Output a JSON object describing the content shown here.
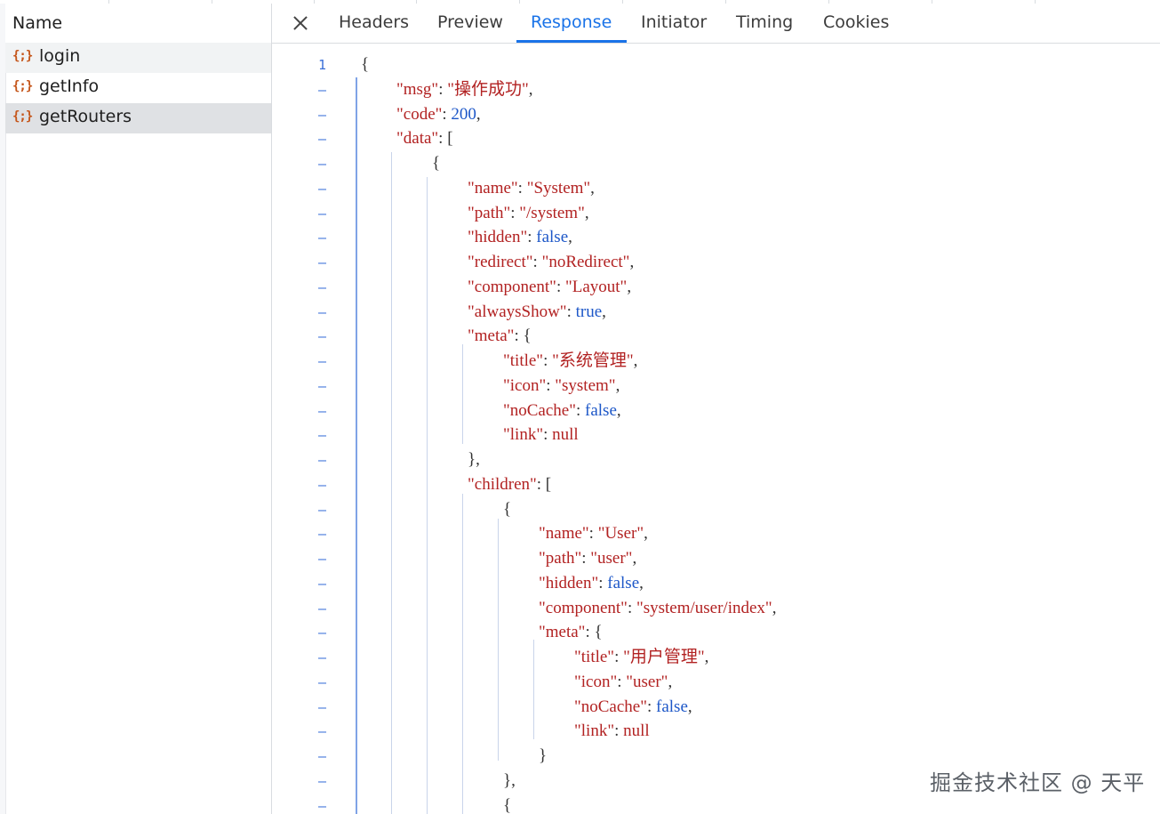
{
  "requests_header": "Name",
  "requests": [
    {
      "label": "login",
      "icon": "json-icon",
      "state": "alt"
    },
    {
      "label": "getInfo",
      "icon": "json-icon",
      "state": "normal"
    },
    {
      "label": "getRouters",
      "icon": "json-icon",
      "state": "selected"
    }
  ],
  "icon_glyph": "{;}",
  "tabs": [
    "Headers",
    "Preview",
    "Response",
    "Initiator",
    "Timing",
    "Cookies"
  ],
  "active_tab": "Response",
  "gutter": {
    "first": "1",
    "collapsed": "–"
  },
  "colors": {
    "accent": "#1a73e8",
    "string": "#b22222",
    "literal": "#1d57c8",
    "json_icon": "#c5561b"
  },
  "code_lines": [
    [
      {
        "t": "p",
        "v": "{"
      }
    ],
    [
      {
        "t": "k",
        "v": "\"msg\""
      },
      {
        "t": "p",
        "v": ": "
      },
      {
        "t": "s",
        "v": "\"操作成功\""
      },
      {
        "t": "p",
        "v": ","
      }
    ],
    [
      {
        "t": "k",
        "v": "\"code\""
      },
      {
        "t": "p",
        "v": ": "
      },
      {
        "t": "n",
        "v": "200"
      },
      {
        "t": "p",
        "v": ","
      }
    ],
    [
      {
        "t": "k",
        "v": "\"data\""
      },
      {
        "t": "p",
        "v": ": ["
      }
    ],
    [
      {
        "t": "p",
        "v": "{"
      }
    ],
    [
      {
        "t": "k",
        "v": "\"name\""
      },
      {
        "t": "p",
        "v": ": "
      },
      {
        "t": "s",
        "v": "\"System\""
      },
      {
        "t": "p",
        "v": ","
      }
    ],
    [
      {
        "t": "k",
        "v": "\"path\""
      },
      {
        "t": "p",
        "v": ": "
      },
      {
        "t": "s",
        "v": "\"/system\""
      },
      {
        "t": "p",
        "v": ","
      }
    ],
    [
      {
        "t": "k",
        "v": "\"hidden\""
      },
      {
        "t": "p",
        "v": ": "
      },
      {
        "t": "n",
        "v": "false"
      },
      {
        "t": "p",
        "v": ","
      }
    ],
    [
      {
        "t": "k",
        "v": "\"redirect\""
      },
      {
        "t": "p",
        "v": ": "
      },
      {
        "t": "s",
        "v": "\"noRedirect\""
      },
      {
        "t": "p",
        "v": ","
      }
    ],
    [
      {
        "t": "k",
        "v": "\"component\""
      },
      {
        "t": "p",
        "v": ": "
      },
      {
        "t": "s",
        "v": "\"Layout\""
      },
      {
        "t": "p",
        "v": ","
      }
    ],
    [
      {
        "t": "k",
        "v": "\"alwaysShow\""
      },
      {
        "t": "p",
        "v": ": "
      },
      {
        "t": "n",
        "v": "true"
      },
      {
        "t": "p",
        "v": ","
      }
    ],
    [
      {
        "t": "k",
        "v": "\"meta\""
      },
      {
        "t": "p",
        "v": ": {"
      }
    ],
    [
      {
        "t": "k",
        "v": "\"title\""
      },
      {
        "t": "p",
        "v": ": "
      },
      {
        "t": "s",
        "v": "\"系统管理\""
      },
      {
        "t": "p",
        "v": ","
      }
    ],
    [
      {
        "t": "k",
        "v": "\"icon\""
      },
      {
        "t": "p",
        "v": ": "
      },
      {
        "t": "s",
        "v": "\"system\""
      },
      {
        "t": "p",
        "v": ","
      }
    ],
    [
      {
        "t": "k",
        "v": "\"noCache\""
      },
      {
        "t": "p",
        "v": ": "
      },
      {
        "t": "n",
        "v": "false"
      },
      {
        "t": "p",
        "v": ","
      }
    ],
    [
      {
        "t": "k",
        "v": "\"link\""
      },
      {
        "t": "p",
        "v": ": "
      },
      {
        "t": "s",
        "v": "null"
      }
    ],
    [
      {
        "t": "p",
        "v": "},"
      }
    ],
    [
      {
        "t": "k",
        "v": "\"children\""
      },
      {
        "t": "p",
        "v": ": ["
      }
    ],
    [
      {
        "t": "p",
        "v": "{"
      }
    ],
    [
      {
        "t": "k",
        "v": "\"name\""
      },
      {
        "t": "p",
        "v": ": "
      },
      {
        "t": "s",
        "v": "\"User\""
      },
      {
        "t": "p",
        "v": ","
      }
    ],
    [
      {
        "t": "k",
        "v": "\"path\""
      },
      {
        "t": "p",
        "v": ": "
      },
      {
        "t": "s",
        "v": "\"user\""
      },
      {
        "t": "p",
        "v": ","
      }
    ],
    [
      {
        "t": "k",
        "v": "\"hidden\""
      },
      {
        "t": "p",
        "v": ": "
      },
      {
        "t": "n",
        "v": "false"
      },
      {
        "t": "p",
        "v": ","
      }
    ],
    [
      {
        "t": "k",
        "v": "\"component\""
      },
      {
        "t": "p",
        "v": ": "
      },
      {
        "t": "s",
        "v": "\"system/user/index\""
      },
      {
        "t": "p",
        "v": ","
      }
    ],
    [
      {
        "t": "k",
        "v": "\"meta\""
      },
      {
        "t": "p",
        "v": ": {"
      }
    ],
    [
      {
        "t": "k",
        "v": "\"title\""
      },
      {
        "t": "p",
        "v": ": "
      },
      {
        "t": "s",
        "v": "\"用户管理\""
      },
      {
        "t": "p",
        "v": ","
      }
    ],
    [
      {
        "t": "k",
        "v": "\"icon\""
      },
      {
        "t": "p",
        "v": ": "
      },
      {
        "t": "s",
        "v": "\"user\""
      },
      {
        "t": "p",
        "v": ","
      }
    ],
    [
      {
        "t": "k",
        "v": "\"noCache\""
      },
      {
        "t": "p",
        "v": ": "
      },
      {
        "t": "n",
        "v": "false"
      },
      {
        "t": "p",
        "v": ","
      }
    ],
    [
      {
        "t": "k",
        "v": "\"link\""
      },
      {
        "t": "p",
        "v": ": "
      },
      {
        "t": "s",
        "v": "null"
      }
    ],
    [
      {
        "t": "p",
        "v": "}"
      }
    ],
    [
      {
        "t": "p",
        "v": "},"
      }
    ],
    [
      {
        "t": "p",
        "v": "{"
      }
    ]
  ],
  "watermark": "掘金技术社区 @ 天平"
}
